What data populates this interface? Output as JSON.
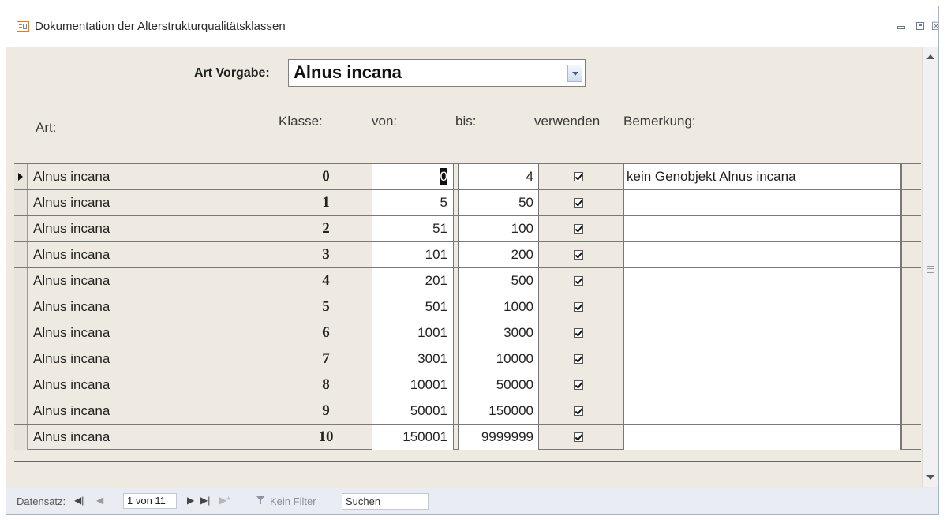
{
  "window": {
    "title": "Dokumentation der Alterstrukturqualitätsklassen",
    "close_glyph": "☒"
  },
  "header": {
    "art_vorgabe_label": "Art Vorgabe:",
    "art_vorgabe_value": "Alnus incana",
    "col_art": "Art:",
    "col_klasse": "Klasse:",
    "col_von": "von:",
    "col_bis": "bis:",
    "col_verwenden": "verwenden",
    "col_bemerkung": "Bemerkung:"
  },
  "rows": [
    {
      "art": "Alnus incana",
      "klasse": "0",
      "von": "0",
      "bis": "4",
      "verwenden": true,
      "bemerkung": "kein Genobjekt Alnus incana"
    },
    {
      "art": "Alnus incana",
      "klasse": "1",
      "von": "5",
      "bis": "50",
      "verwenden": true,
      "bemerkung": ""
    },
    {
      "art": "Alnus incana",
      "klasse": "2",
      "von": "51",
      "bis": "100",
      "verwenden": true,
      "bemerkung": ""
    },
    {
      "art": "Alnus incana",
      "klasse": "3",
      "von": "101",
      "bis": "200",
      "verwenden": true,
      "bemerkung": ""
    },
    {
      "art": "Alnus incana",
      "klasse": "4",
      "von": "201",
      "bis": "500",
      "verwenden": true,
      "bemerkung": ""
    },
    {
      "art": "Alnus incana",
      "klasse": "5",
      "von": "501",
      "bis": "1000",
      "verwenden": true,
      "bemerkung": ""
    },
    {
      "art": "Alnus incana",
      "klasse": "6",
      "von": "1001",
      "bis": "3000",
      "verwenden": true,
      "bemerkung": ""
    },
    {
      "art": "Alnus incana",
      "klasse": "7",
      "von": "3001",
      "bis": "10000",
      "verwenden": true,
      "bemerkung": ""
    },
    {
      "art": "Alnus incana",
      "klasse": "8",
      "von": "10001",
      "bis": "50000",
      "verwenden": true,
      "bemerkung": ""
    },
    {
      "art": "Alnus incana",
      "klasse": "9",
      "von": "50001",
      "bis": "150000",
      "verwenden": true,
      "bemerkung": ""
    },
    {
      "art": "Alnus incana",
      "klasse": "10",
      "von": "150001",
      "bis": "9999999",
      "verwenden": true,
      "bemerkung": ""
    }
  ],
  "navigation": {
    "label": "Datensatz:",
    "first_glyph": "◀|",
    "prev_glyph": "◀",
    "position": "1 von 11",
    "next_glyph": "▶",
    "last_glyph": "▶|",
    "new_glyph": "▶*",
    "filter_label": "Kein Filter",
    "search_label": "Suchen"
  }
}
